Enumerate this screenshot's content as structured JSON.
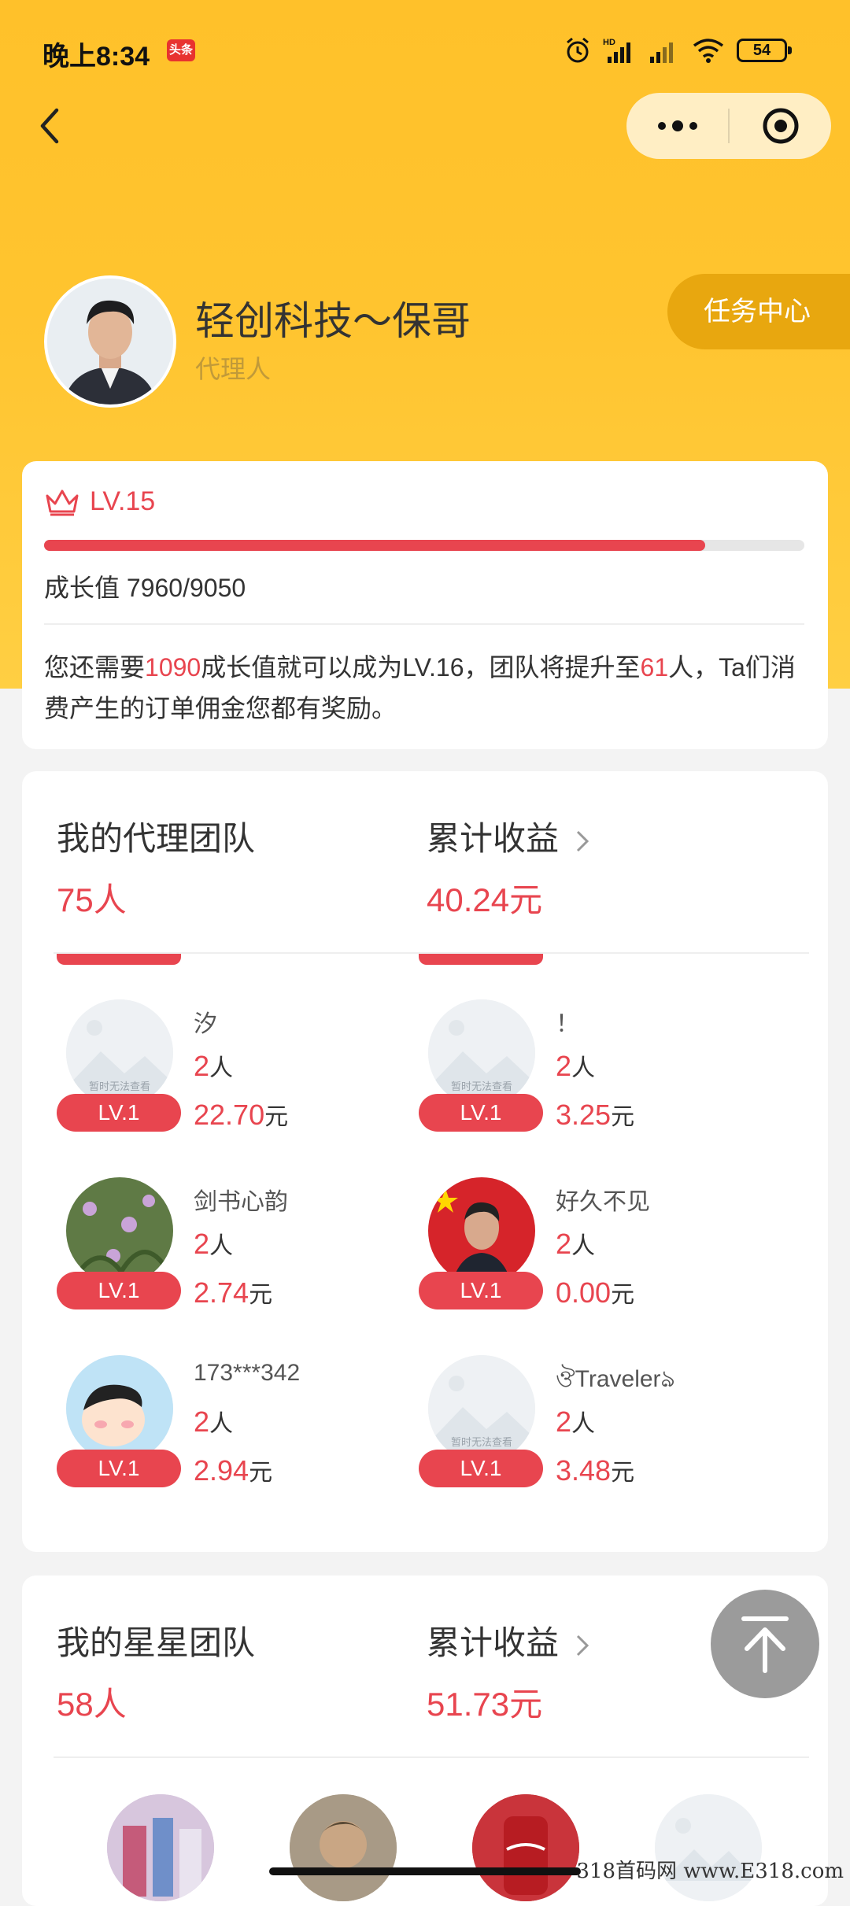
{
  "status_bar": {
    "time": "晚上8:34",
    "app_badge": "头条",
    "network_label": "HD",
    "battery": "54"
  },
  "nav": {
    "back_icon": "chevron-left-icon",
    "more_icon": "more-dots-icon",
    "close_icon": "target-circle-icon"
  },
  "profile": {
    "name": "轻创科技～保哥",
    "role": "代理人",
    "task_center": "任务中心"
  },
  "level": {
    "crown_icon": "crown-icon",
    "label": "LV.15",
    "progress": 0.87,
    "growth_text": "成长值 7960/9050",
    "desc_prefix": "您还需要",
    "desc_need": "1090",
    "desc_mid": "成长值就可以成为LV.16，团队将提升至",
    "desc_team": "61",
    "desc_suffix": "人，Ta们消费产生的订单佣金您都有奖励。"
  },
  "agent_team": {
    "title": "我的代理团队",
    "count": "75人",
    "earnings_title": "累计收益",
    "earnings_value": "40.24元",
    "members": [
      {
        "name": "汐",
        "count": "2",
        "count_unit": "人",
        "amount": "22.70",
        "amount_unit": "元",
        "level": "LV.1",
        "avatar_placeholder": "暂时无法查看",
        "avatar": "placeholder"
      },
      {
        "name": "！",
        "count": "2",
        "count_unit": "人",
        "amount": "3.25",
        "amount_unit": "元",
        "level": "LV.1",
        "avatar_placeholder": "暂时无法查看",
        "avatar": "placeholder"
      },
      {
        "name": "剑书心韵",
        "count": "2",
        "count_unit": "人",
        "amount": "2.74",
        "amount_unit": "元",
        "level": "LV.1",
        "avatar": "flowers"
      },
      {
        "name": "好久不见",
        "count": "2",
        "count_unit": "人",
        "amount": "0.00",
        "amount_unit": "元",
        "level": "LV.1",
        "avatar": "flag-portrait"
      },
      {
        "name": "173***342",
        "count": "2",
        "count_unit": "人",
        "amount": "2.94",
        "amount_unit": "元",
        "level": "LV.1",
        "avatar": "cartoon"
      },
      {
        "name": "ঔTravelerঌ",
        "count": "2",
        "count_unit": "人",
        "amount": "3.48",
        "amount_unit": "元",
        "level": "LV.1",
        "avatar_placeholder": "暂时无法查看",
        "avatar": "placeholder"
      }
    ]
  },
  "star_team": {
    "title": "我的星星团队",
    "count": "58人",
    "earnings_title": "累计收益",
    "earnings_value": "51.73元"
  },
  "scroll_top_icon": "arrow-up-to-top-icon",
  "watermark": "318首码网 www.E318.com",
  "colors": {
    "header_yellow": "#ffc12a",
    "accent_red": "#e8454f",
    "task_button": "#e8a70f",
    "role_text": "#c19a39"
  }
}
